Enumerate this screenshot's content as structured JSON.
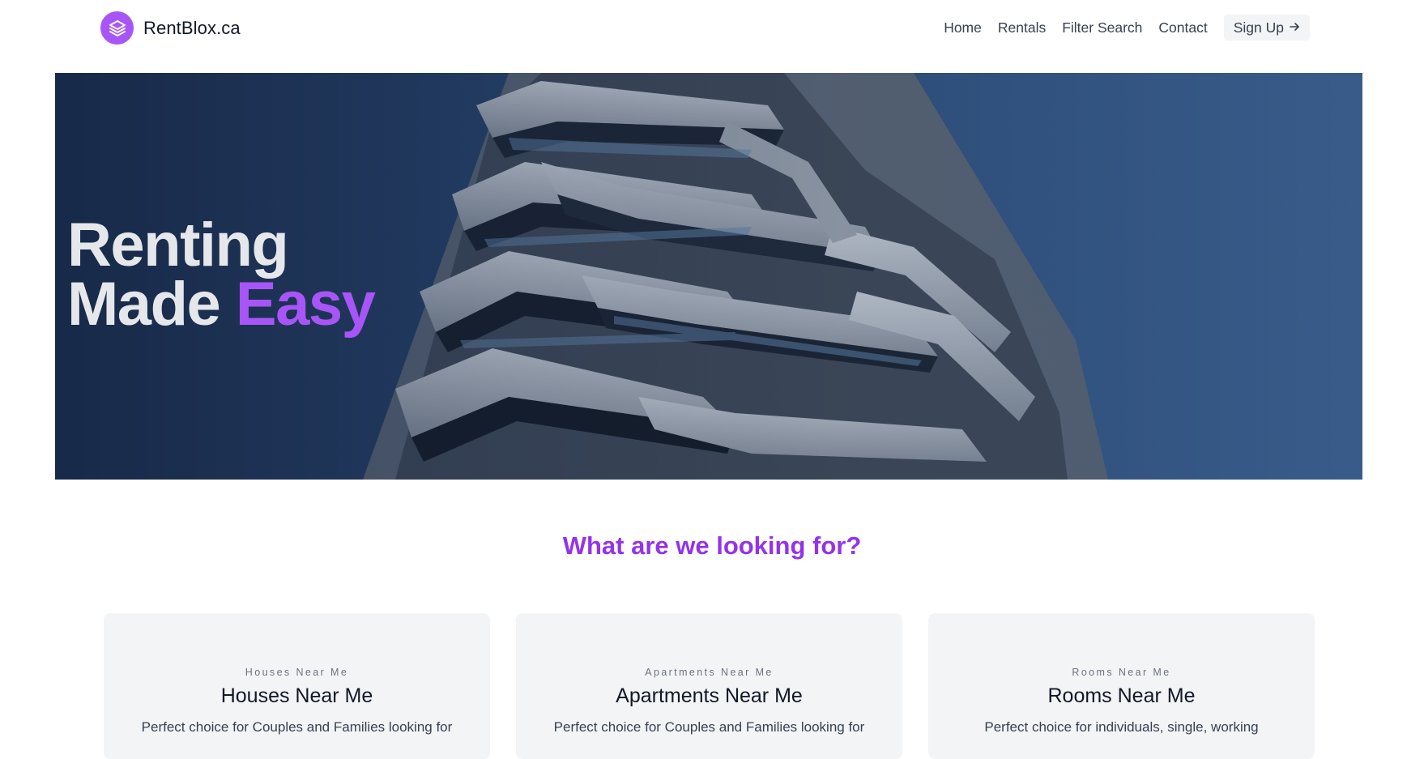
{
  "header": {
    "brand_name": "RentBlox.ca",
    "logo_icon": "layers-icon",
    "nav": [
      "Home",
      "Rentals",
      "Filter Search",
      "Contact"
    ],
    "signup_label": "Sign Up",
    "signup_icon": "arrow-right-icon"
  },
  "hero": {
    "title_line1": "Renting",
    "title_line2_plain": "Made",
    "title_line2_accent": "Easy",
    "accent_color": "#a855f7",
    "image": "apartment-building-photo"
  },
  "section": {
    "heading": "What are we looking for?",
    "heading_color": "#9333ea"
  },
  "cards": [
    {
      "eyebrow": "Houses Near Me",
      "title": "Houses Near Me",
      "description": "Perfect choice for Couples and Families looking for"
    },
    {
      "eyebrow": "Apartments Near Me",
      "title": "Apartments Near Me",
      "description": "Perfect choice for Couples and Families looking for"
    },
    {
      "eyebrow": "Rooms Near Me",
      "title": "Rooms Near Me",
      "description": "Perfect choice for individuals, single, working"
    }
  ]
}
